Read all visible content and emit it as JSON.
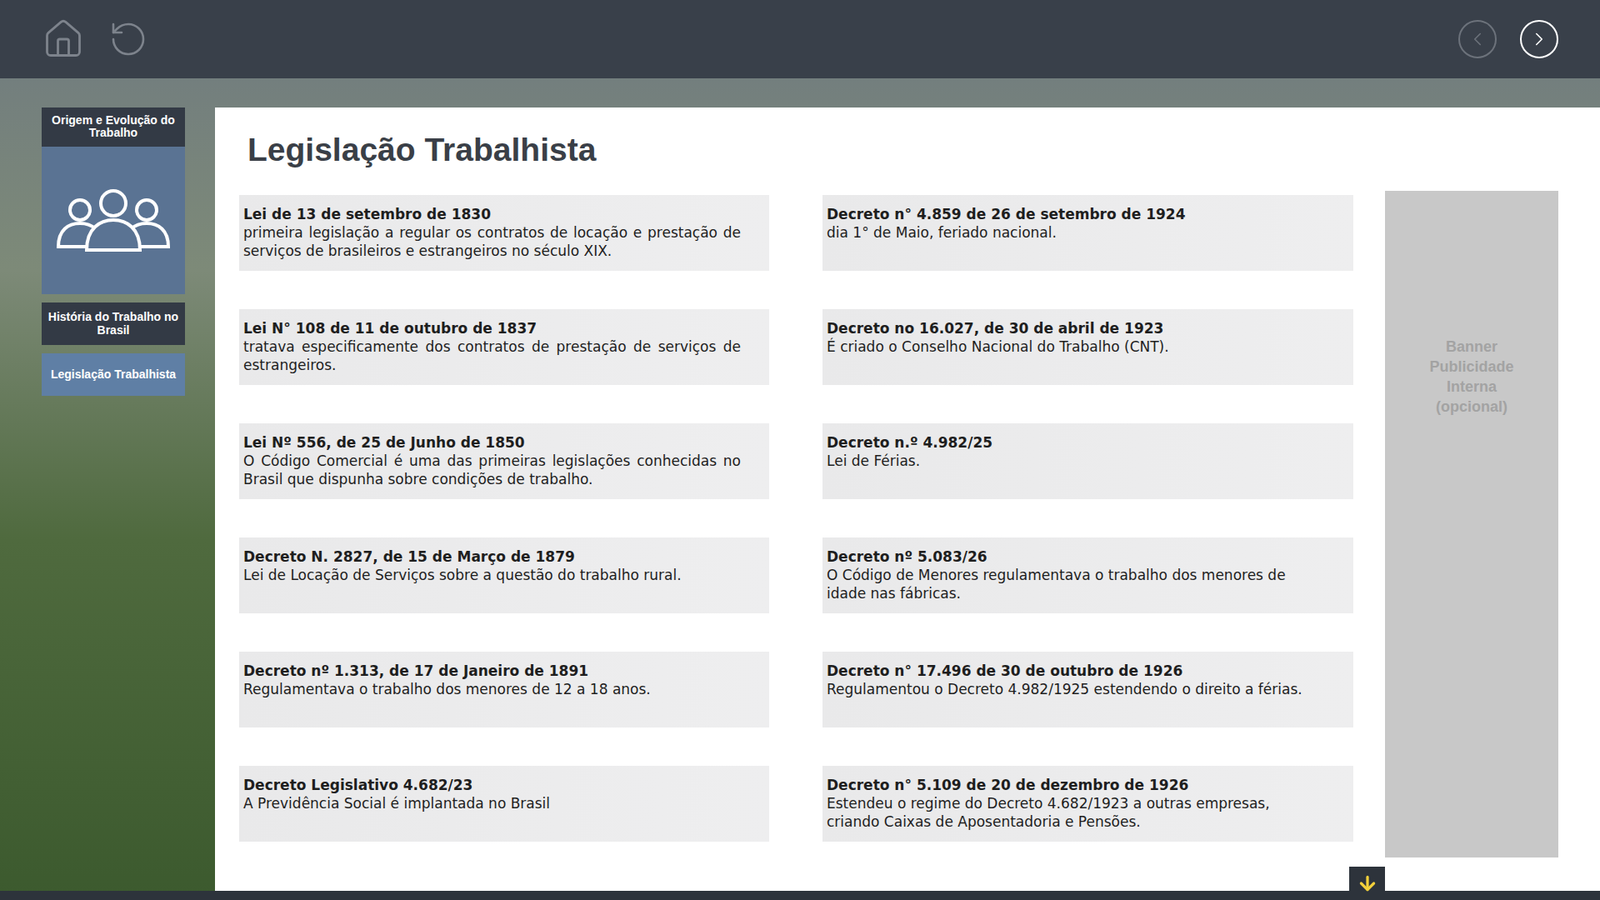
{
  "nav": {
    "previous": {
      "disabled": true
    },
    "next": {
      "disabled": false
    }
  },
  "sidebar": {
    "header": "Origem e Evolução do Trabalho",
    "items": [
      {
        "label": "História do Trabalho no Brasil",
        "selected": false
      },
      {
        "label": "Legislação Trabalhista",
        "selected": true
      }
    ]
  },
  "page": {
    "title": "Legislação Trabalhista"
  },
  "laws": {
    "left": [
      {
        "title": "Lei de 13 de setembro de 1830",
        "text": "primeira legislação a regular os contratos de locação e prestação de serviços de brasileiros e estrangeiros no século XIX."
      },
      {
        "title": "Lei N° 108 de 11 de outubro de 1837",
        "text": "tratava especificamente dos contratos de prestação de serviços de estrangeiros."
      },
      {
        "title": "Lei Nº 556, de 25 de Junho de 1850",
        "text": "O Código Comercial é uma das primeiras legislações conhecidas no Brasil que dispunha sobre condições de trabalho."
      },
      {
        "title": "Decreto N. 2827, de 15 de Março de 1879",
        "text": "Lei de Locação de Serviços sobre a questão do trabalho rural."
      },
      {
        "title": "Decreto nº 1.313, de 17 de Janeiro de 1891",
        "text": "Regulamentava o trabalho dos menores de 12 a 18 anos."
      },
      {
        "title": "Decreto Legislativo 4.682/23",
        "text": "A Previdência Social é implantada no Brasil"
      }
    ],
    "right": [
      {
        "title": "Decreto n° 4.859 de 26 de setembro de 1924",
        "text": "dia 1° de Maio, feriado nacional."
      },
      {
        "title": "Decreto no 16.027, de 30 de abril de 1923",
        "text": "É criado o Conselho Nacional do Trabalho (CNT)."
      },
      {
        "title": "Decreto n.º 4.982/25",
        "text": "Lei de Férias."
      },
      {
        "title": "Decreto nº 5.083/26",
        "text": "O Código de Menores regulamentava o trabalho dos menores de idade nas fábricas."
      },
      {
        "title": "Decreto n° 17.496 de 30 de outubro de 1926",
        "text": "Regulamentou o Decreto 4.982/1925 estendendo o direito a férias."
      },
      {
        "title": "Decreto n° 5.109 de 20 de dezembro de 1926",
        "text": "Estendeu o regime do Decreto 4.682/1923 a outras empresas, criando Caixas de Aposentadoria e Pensões."
      }
    ]
  },
  "banner": "Banner Publicidade Interna (opcional)"
}
